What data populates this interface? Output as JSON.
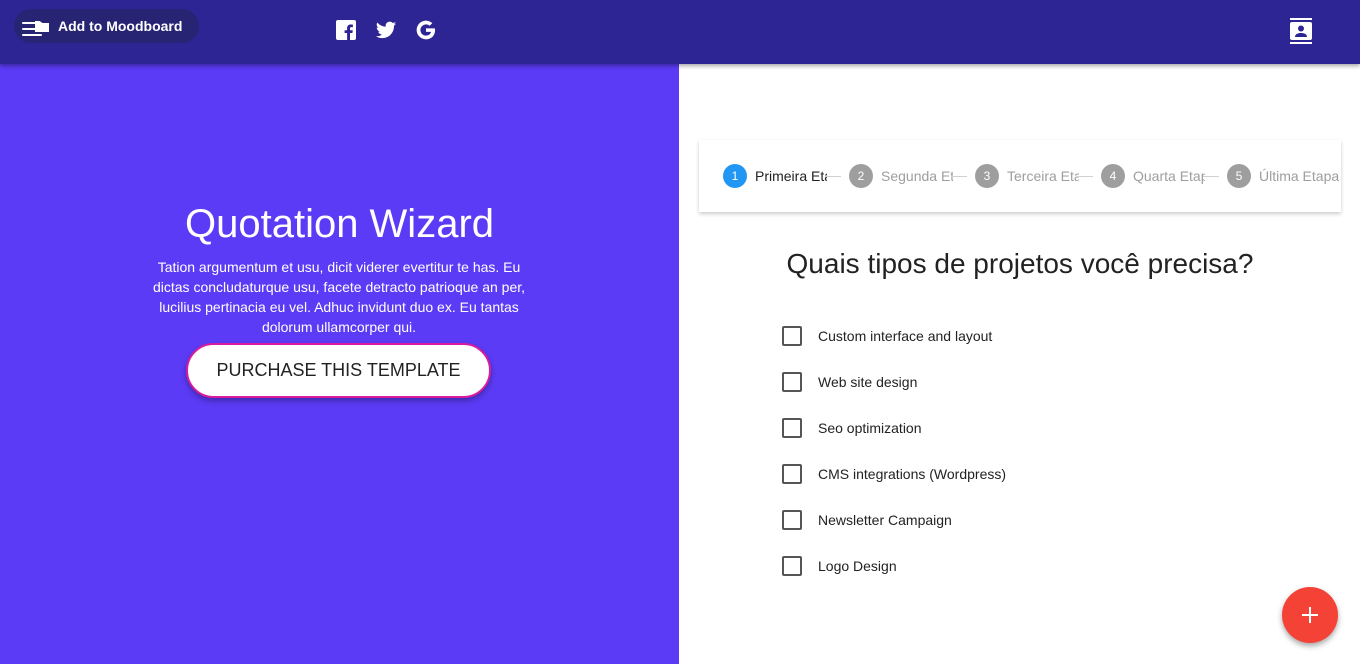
{
  "header": {
    "moodboard_label": "Add to Moodboard",
    "social_icons": [
      "facebook-icon",
      "twitter-icon",
      "google-icon"
    ],
    "account_icon": "contacts-icon"
  },
  "hero": {
    "title": "Quotation Wizard",
    "text": "Tation argumentum et usu, dicit viderer evertitur te has. Eu dictas concludaturque usu, facete detracto patrioque an per, lucilius pertinacia eu vel. Adhuc invidunt duo ex. Eu tantas dolorum ullamcorper qui.",
    "button_label": "PURCHASE THIS TEMPLATE",
    "background_color": "#5b3bf5"
  },
  "stepper": {
    "steps": [
      {
        "number": "1",
        "label": "Primeira Etapa"
      },
      {
        "number": "2",
        "label": "Segunda Etapa"
      },
      {
        "number": "3",
        "label": "Terceira Etapa"
      },
      {
        "number": "4",
        "label": "Quarta Etapa"
      },
      {
        "number": "5",
        "label": "Última Etapa"
      }
    ],
    "active_step": 1,
    "active_color": "#2196f3"
  },
  "form": {
    "question": "Quais tipos de projetos você precisa?",
    "options": [
      {
        "label": "Custom interface and layout",
        "checked": false
      },
      {
        "label": "Web site design",
        "checked": false
      },
      {
        "label": "Seo optimization",
        "checked": false
      },
      {
        "label": "CMS integrations (Wordpress)",
        "checked": false
      },
      {
        "label": "Newsletter Campaign",
        "checked": false
      },
      {
        "label": "Logo Design",
        "checked": false
      }
    ]
  },
  "fab": {
    "icon": "plus-icon",
    "color": "#f44336"
  }
}
